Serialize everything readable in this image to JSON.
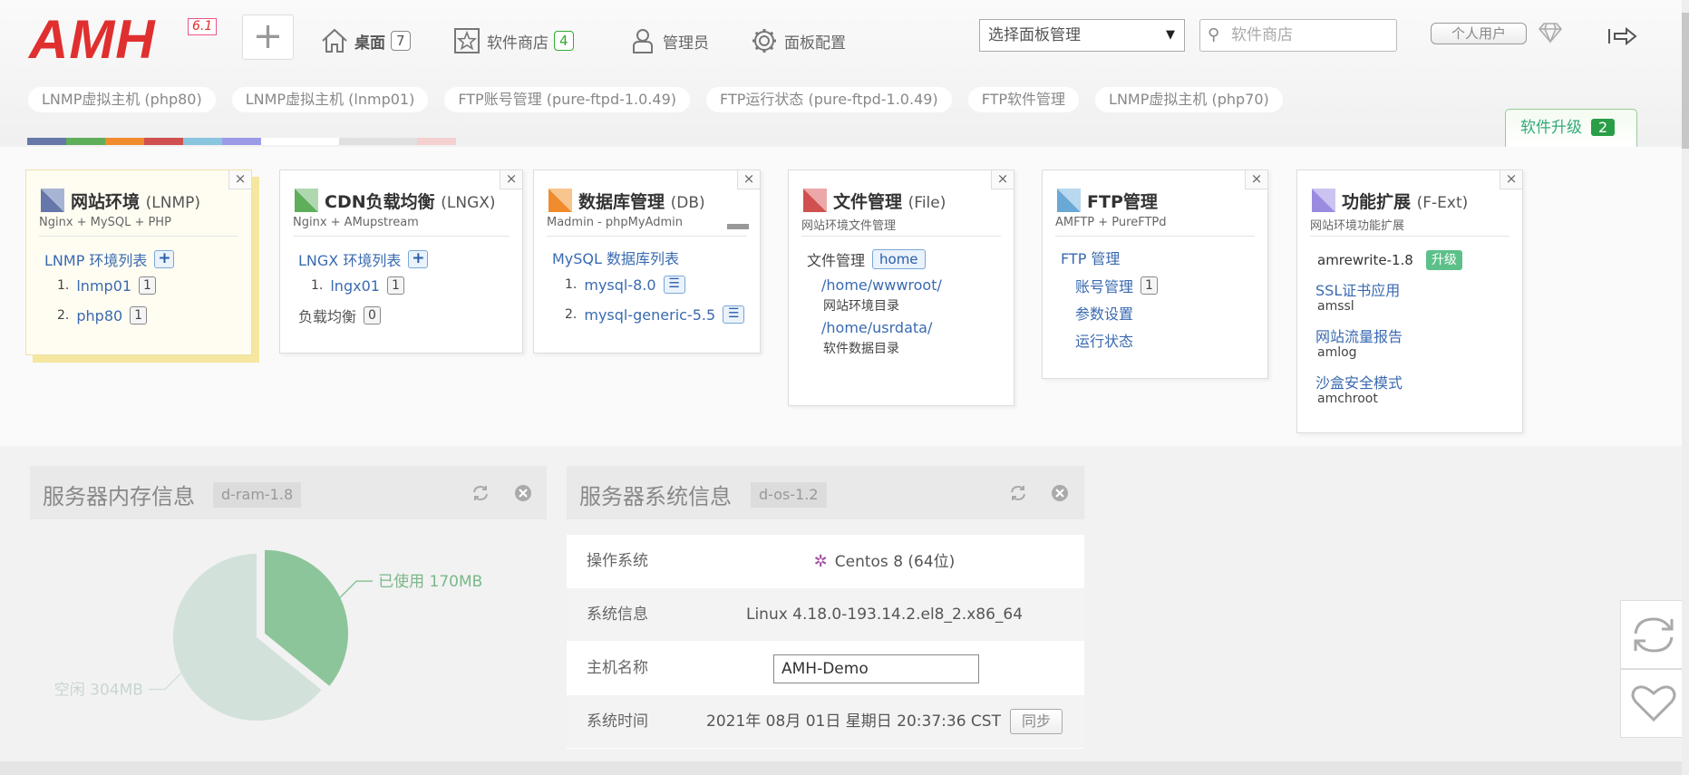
{
  "logo": {
    "text": "AMH",
    "version": "6.1"
  },
  "nav": {
    "add_label": "+",
    "desktop": {
      "label": "桌面",
      "count": "7"
    },
    "store": {
      "label": "软件商店",
      "count": "4"
    },
    "admin": {
      "label": "管理员"
    },
    "config": {
      "label": "面板配置"
    }
  },
  "panel_select": {
    "value": "选择面板管理"
  },
  "search": {
    "placeholder": "软件商店"
  },
  "user_button": "个人用户",
  "tabs": [
    "LNMP虚拟主机 (php80)",
    "LNMP虚拟主机 (lnmp01)",
    "FTP账号管理 (pure-ftpd-1.0.49)",
    "FTP运行状态 (pure-ftpd-1.0.49)",
    "FTP软件管理",
    "LNMP虚拟主机 (php70)"
  ],
  "color_strip": [
    "#6677aa",
    "#5fae5a",
    "#f08c2e",
    "#d05050",
    "#8ac5e0",
    "#9b9be8",
    "#ffffff",
    "#ffffff",
    "#e0e0e0",
    "#e0e0e0",
    "#f4d0d0"
  ],
  "upgrade": {
    "label": "软件升级",
    "count": "2"
  },
  "modules": {
    "lnmp": {
      "title": "网站环境",
      "title_en": "(LNMP)",
      "sub": "Nginx + MySQL + PHP",
      "list_label": "LNMP 环境列表",
      "plus": "+",
      "items": [
        {
          "idx": "1.",
          "name": "lnmp01",
          "count": "1"
        },
        {
          "idx": "2.",
          "name": "php80",
          "count": "1"
        }
      ]
    },
    "lngx": {
      "title": "CDN负载均衡",
      "title_en": "(LNGX)",
      "sub": "Nginx + AMupstream",
      "list_label": "LNGX 环境列表",
      "plus": "+",
      "items": [
        {
          "idx": "1.",
          "name": "lngx01",
          "count": "1"
        }
      ],
      "lb_label": "负载均衡",
      "lb_count": "0"
    },
    "db": {
      "title": "数据库管理",
      "title_en": "(DB)",
      "sub": "Madmin - phpMyAdmin",
      "list_label": "MySQL 数据库列表",
      "items": [
        {
          "idx": "1.",
          "name": "mysql-8.0",
          "btn": "☰"
        },
        {
          "idx": "2.",
          "name": "mysql-generic-5.5",
          "btn": "☰"
        }
      ]
    },
    "file": {
      "title": "文件管理",
      "title_en": "(File)",
      "sub": "网站环境文件管理",
      "label": "文件管理",
      "home": "home",
      "path1": "/home/wwwroot/",
      "desc1": "网站环境目录",
      "path2": "/home/usrdata/",
      "desc2": "软件数据目录"
    },
    "ftp": {
      "title": "FTP管理",
      "title_en": "",
      "sub": "AMFTP + PureFTPd",
      "label": "FTP 管理",
      "account": "账号管理",
      "account_count": "1",
      "params": "参数设置",
      "status": "运行状态"
    },
    "ext": {
      "title": "功能扩展",
      "title_en": "(F-Ext)",
      "sub": "网站环境功能扩展",
      "items": [
        {
          "name": "amrewrite-1.8",
          "badge": "升级"
        },
        {
          "name": "SSL证书应用",
          "sub": "amssl"
        },
        {
          "name": "网站流量报告",
          "sub": "amlog"
        },
        {
          "name": "沙盒安全模式",
          "sub": "amchroot"
        }
      ]
    }
  },
  "close_symbol": "×",
  "ram_panel": {
    "title": "服务器内存信息",
    "badge": "d-ram-1.8"
  },
  "sys_panel": {
    "title": "服务器系统信息",
    "badge": "d-os-1.2"
  },
  "chart_data": {
    "type": "pie",
    "labels": [
      "已使用 170MB",
      "空闲 304MB"
    ],
    "values": [
      170,
      304
    ],
    "colors": [
      "#8cc59a",
      "#d3e1db"
    ]
  },
  "system": {
    "os_label": "操作系统",
    "os_value": "Centos 8 (64位)",
    "info_label": "系统信息",
    "info_value": "Linux 4.18.0-193.14.2.el8_2.x86_64",
    "host_label": "主机名称",
    "host_value": "AMH-Demo",
    "time_label": "系统时间",
    "time_value": "2021年 08月 01日 星期日 20:37:36 CST",
    "sync_label": "同步"
  }
}
